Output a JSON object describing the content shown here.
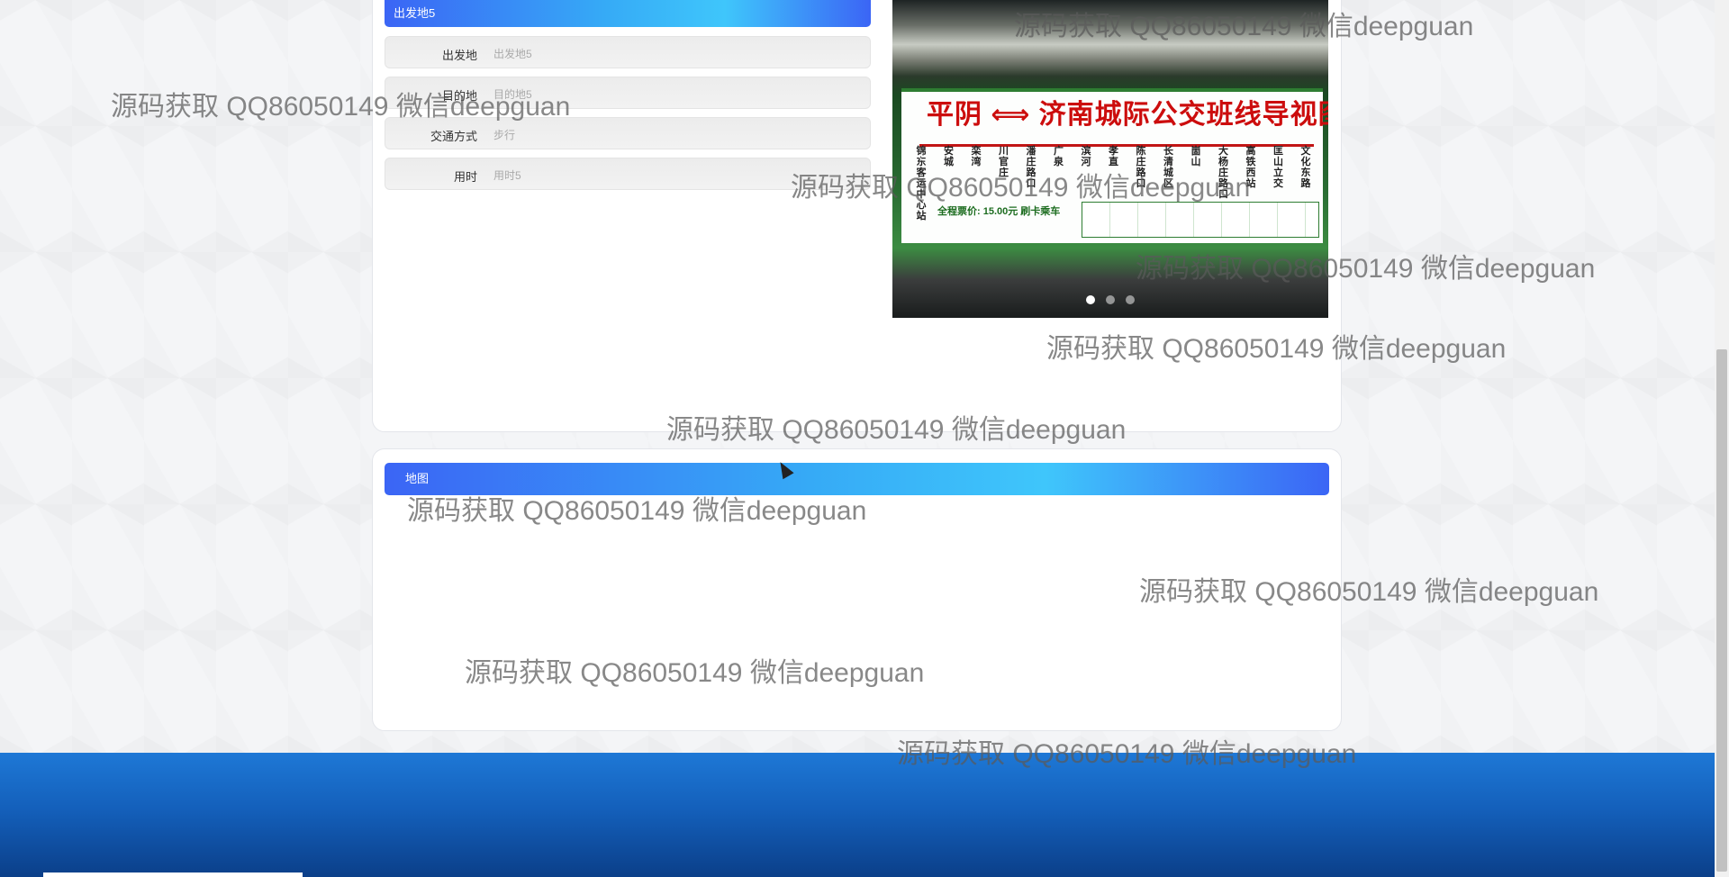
{
  "detail": {
    "title": "出发地5",
    "fields": [
      {
        "label": "出发地",
        "value": "出发地5"
      },
      {
        "label": "目的地",
        "value": "目的地5"
      },
      {
        "label": "交通方式",
        "value": "步行"
      },
      {
        "label": "用时",
        "value": "用时5"
      }
    ]
  },
  "carousel": {
    "sign_title": "平阴 ⟺ 济南城际公交班线导视图",
    "sign_price": "全程票价: 15.00元 刷卡乘车",
    "stops": [
      "锦东客运中心站",
      "安城",
      "栾湾",
      "川官庄",
      "潘庄路口",
      "广泉",
      "滨河",
      "孝直",
      "陈庄路口",
      "长清城区",
      "崮山",
      "大杨庄路口",
      "高铁西站",
      "匡山立交",
      "文化东路"
    ],
    "prev_icon": "chevron-left-icon",
    "next_icon": "chevron-right-icon",
    "slide_count": 3,
    "active_slide": 1
  },
  "map": {
    "title": "地图"
  },
  "watermark": {
    "text": "源码获取 QQ86050149 微信deepguan"
  },
  "colors": {
    "accent_blue": "#3b65f5",
    "accent_cyan": "#3fc6fb",
    "footer_blue": "#1460bb"
  }
}
